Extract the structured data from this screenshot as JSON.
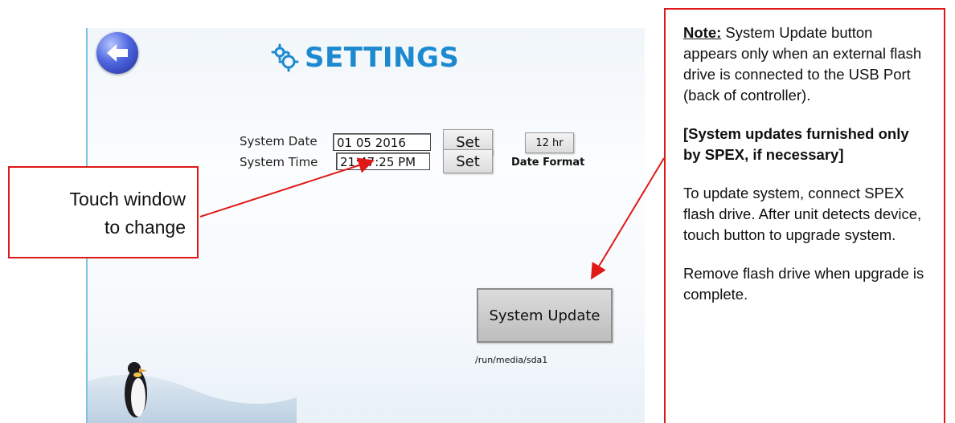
{
  "page": {
    "title": "SETTINGS",
    "icons": {
      "back": "back-arrow-icon",
      "title": "gears-icon"
    }
  },
  "settings": {
    "system_date": {
      "label": "System Date",
      "value": "01 05 2016",
      "set_label": "Set"
    },
    "system_time": {
      "label": "System Time",
      "value": "21:47:25 PM",
      "set_label": "Set"
    },
    "hour_format_button": "12 hr",
    "date_format_label": "Date Format",
    "system_update_button": "System Update",
    "media_path": "/run/media/sda1"
  },
  "callouts": {
    "left": {
      "line1": "Touch window",
      "line2": "to change"
    },
    "right": {
      "note_label": "Note:",
      "note_text": " System Update button appears only when an external flash drive is connected to the USB Port (back of controller).",
      "bold_text": "[System updates furnished only by SPEX, if necessary]",
      "update_text": "To update system, connect SPEX flash drive.  After unit detects device, touch button to upgrade system.",
      "remove_text": "Remove flash drive when upgrade is complete."
    }
  },
  "colors": {
    "accent": "#1d8ad0",
    "callout_border": "#e01818",
    "screen_border": "#7cc4e8"
  }
}
